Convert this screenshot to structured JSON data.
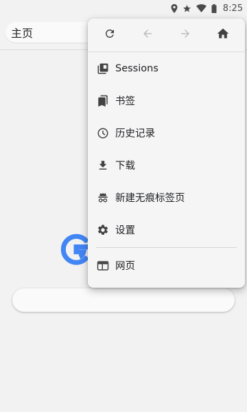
{
  "status_bar": {
    "time": "8:25",
    "icons": [
      "location-icon",
      "star-icon",
      "wifi-icon",
      "battery-icon"
    ]
  },
  "toolbar": {
    "url_text": "主页"
  },
  "menu": {
    "nav_buttons": [
      "reload-icon",
      "back-icon",
      "forward-icon",
      "home-icon"
    ],
    "items": [
      {
        "label": "Sessions",
        "icon": "sessions-icon"
      },
      {
        "label": "书签",
        "icon": "bookmark-icon"
      },
      {
        "label": "历史记录",
        "icon": "history-icon"
      },
      {
        "label": "下载",
        "icon": "download-icon"
      },
      {
        "label": "新建无痕标签页",
        "icon": "incognito-icon"
      },
      {
        "label": "设置",
        "icon": "settings-icon"
      },
      {
        "label": "网页",
        "icon": "web-page-icon"
      }
    ]
  },
  "colors": {
    "background": "#f2f2f2",
    "menu_background": "#f5f5f5",
    "icon_dark": "#424242",
    "icon_disabled": "#bdbdbd",
    "google_blue": "#4285f4"
  }
}
